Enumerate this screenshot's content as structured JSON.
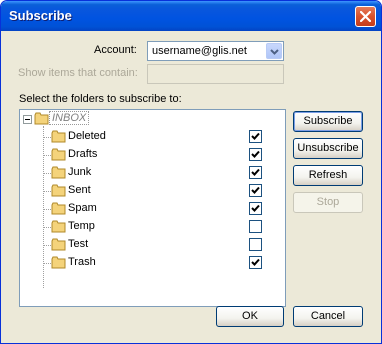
{
  "window": {
    "title": "Subscribe"
  },
  "form": {
    "account_label": "Account:",
    "account_value": "username@glis.net",
    "filter_label": "Show items that contain:",
    "filter_value": "",
    "folders_label": "Select the folders to subscribe to:"
  },
  "tree": {
    "root": "INBOX",
    "folders": [
      {
        "name": "Deleted",
        "subscribed": true
      },
      {
        "name": "Drafts",
        "subscribed": true
      },
      {
        "name": "Junk",
        "subscribed": true
      },
      {
        "name": "Sent",
        "subscribed": true
      },
      {
        "name": "Spam",
        "subscribed": true
      },
      {
        "name": "Temp",
        "subscribed": false
      },
      {
        "name": "Test",
        "subscribed": false
      },
      {
        "name": "Trash",
        "subscribed": true
      }
    ]
  },
  "buttons": {
    "subscribe": "Subscribe",
    "unsubscribe": "Unsubscribe",
    "refresh": "Refresh",
    "stop": "Stop",
    "ok": "OK",
    "cancel": "Cancel"
  },
  "icons": {
    "close": "close-icon",
    "dropdown": "chevron-down-icon",
    "folder": "folder-icon",
    "collapse": "collapse-icon",
    "check": "check-icon"
  },
  "colors": {
    "titlebar": "#0053e1",
    "dialog_bg": "#ece9d8",
    "folder": "#f4d37b",
    "checkbox_border": "#1c5180"
  }
}
